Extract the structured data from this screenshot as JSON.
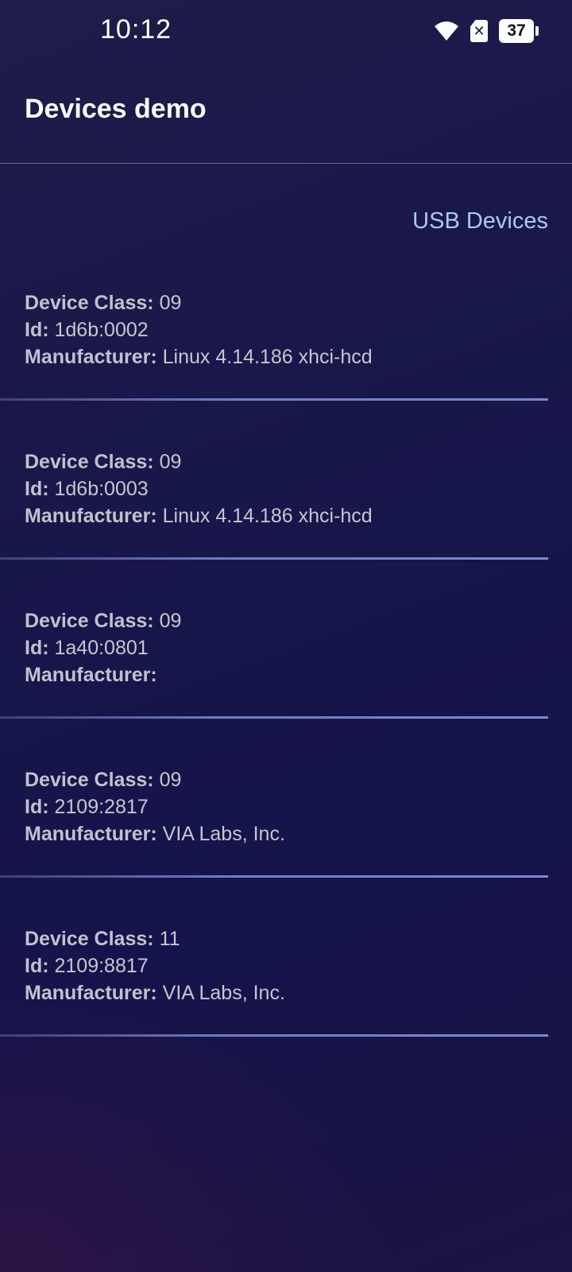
{
  "status_bar": {
    "time": "10:12",
    "battery_level": "37",
    "sim_symbol": "✕",
    "icons": [
      "wifi-icon",
      "sim-icon",
      "battery-icon"
    ]
  },
  "app_bar": {
    "title": "Devices demo"
  },
  "usb_link": "USB Devices",
  "labels": {
    "device_class": "Device Class:",
    "id": "Id:",
    "manufacturer": "Manufacturer:"
  },
  "devices": [
    {
      "device_class": "09",
      "id": "1d6b:0002",
      "manufacturer": "Linux 4.14.186 xhci-hcd"
    },
    {
      "device_class": "09",
      "id": "1d6b:0003",
      "manufacturer": "Linux 4.14.186 xhci-hcd"
    },
    {
      "device_class": "09",
      "id": "1a40:0801",
      "manufacturer": ""
    },
    {
      "device_class": "09",
      "id": "2109:2817",
      "manufacturer": "VIA Labs, Inc."
    },
    {
      "device_class": "11",
      "id": "2109:8817",
      "manufacturer": "VIA Labs, Inc."
    }
  ],
  "colors": {
    "link": "#a9c8f5",
    "divider": "#6f7cc2",
    "background": "#17164a"
  }
}
